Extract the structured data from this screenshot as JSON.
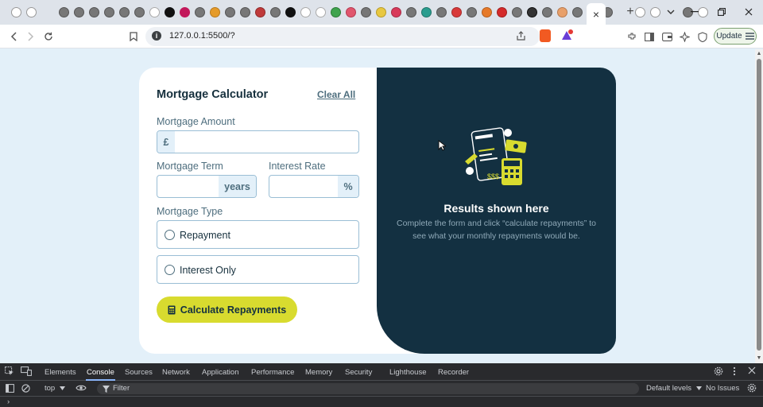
{
  "browser": {
    "active_tab_close": "×",
    "new_tab": "+",
    "url": "127.0.0.1:5500/?",
    "update_label": "Update"
  },
  "app": {
    "title": "Mortgage Calculator",
    "clear_all": "Clear All",
    "amount_label": "Mortgage Amount",
    "amount_prefix": "£",
    "term_label": "Mortgage Term",
    "term_suffix": "years",
    "rate_label": "Interest Rate",
    "rate_suffix": "%",
    "type_label": "Mortgage Type",
    "type_options": [
      "Repayment",
      "Interest Only"
    ],
    "submit_label": "Calculate Repayments",
    "results_title": "Results shown here",
    "results_text": "Complete the form and click “calculate repayments” to see what your monthly repayments would be.",
    "colors": {
      "accent": "#d8db2f",
      "dark_panel": "#133041",
      "field_border": "#9abed5",
      "addon_bg": "#e3f0f9"
    }
  },
  "devtools": {
    "tabs": [
      "Elements",
      "Console",
      "Sources",
      "Network",
      "Application",
      "Performance",
      "Memory",
      "Security",
      "Lighthouse",
      "Recorder"
    ],
    "active_tab": "Console",
    "context": "top",
    "filter_placeholder": "Filter",
    "levels": "Default levels",
    "issues": "No Issues",
    "prompt": "›"
  }
}
